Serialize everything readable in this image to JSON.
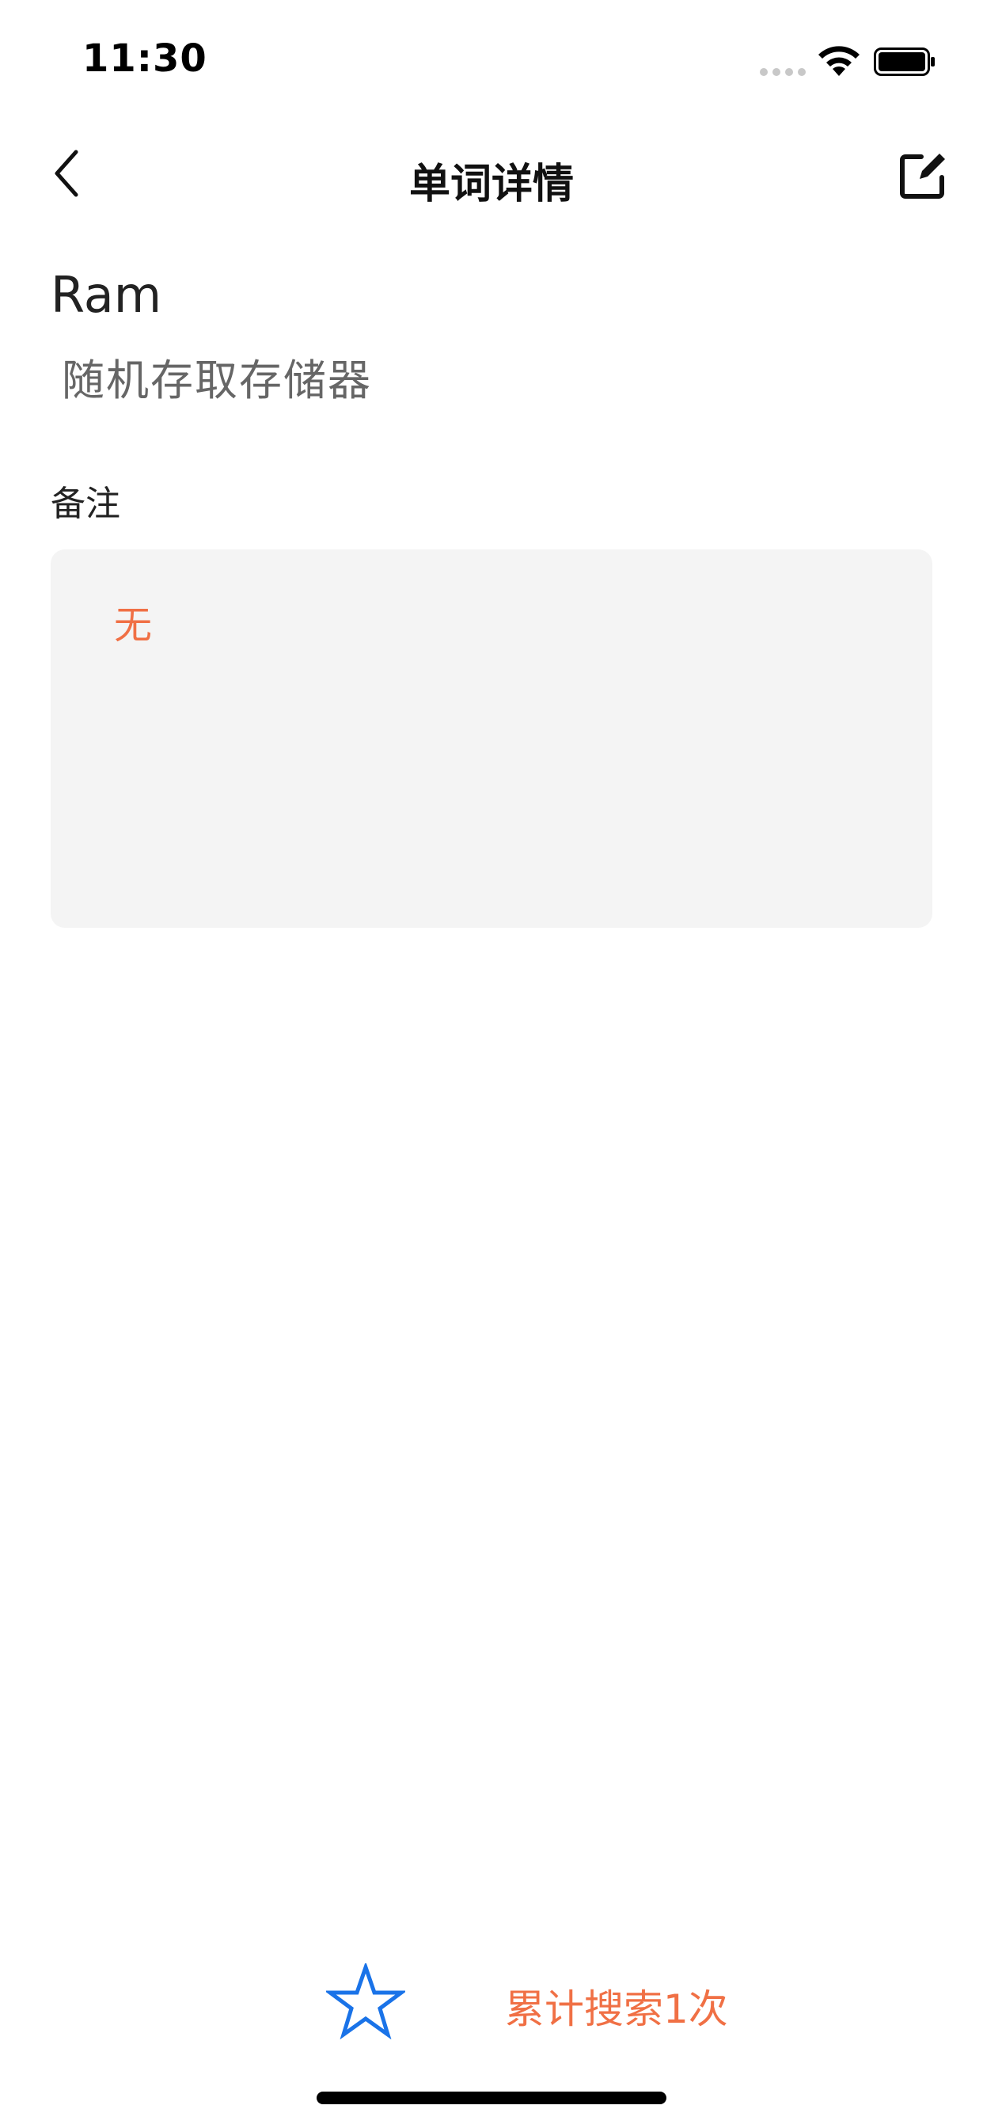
{
  "status_bar": {
    "time": "11:30",
    "wifi_icon": "wifi-icon",
    "battery_icon": "battery-icon"
  },
  "nav": {
    "title": "单词详情",
    "back_icon": "chevron-left-icon",
    "edit_icon": "edit-icon"
  },
  "word": {
    "term": "Ram",
    "meaning": "随机存取存储器"
  },
  "note": {
    "label": "备注",
    "content": "无"
  },
  "footer": {
    "favorite_icon": "star-outline-icon",
    "search_count": "累计搜索1次"
  },
  "colors": {
    "accent_orange": "#f07045",
    "star_blue": "#1a73e8",
    "note_bg": "#f4f4f4"
  }
}
